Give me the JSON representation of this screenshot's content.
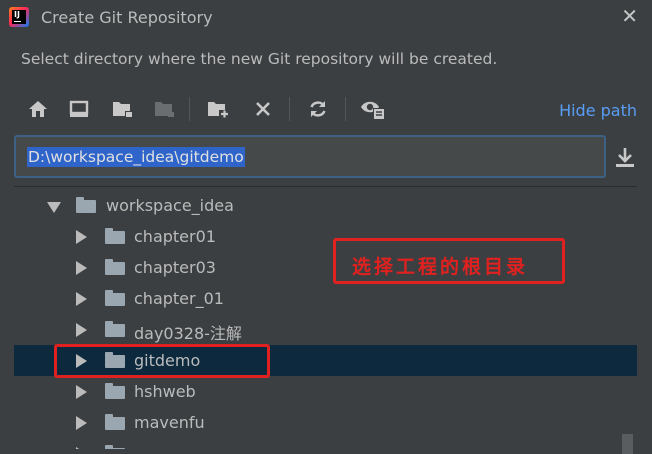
{
  "window": {
    "title": "Create Git Repository",
    "close_glyph": "✕"
  },
  "description": "Select directory where the new Git repository will be created.",
  "toolbar": {
    "buttons": [
      "home-icon",
      "desktop-icon",
      "new-folder-icon",
      "module-folder-icon",
      "new-folder-plus-icon",
      "delete-icon",
      "refresh-icon",
      "show-hidden-icon"
    ],
    "hide_path_label": "Hide path"
  },
  "path": {
    "value": "D:\\workspace_idea\\gitdemo"
  },
  "tree": {
    "items": [
      {
        "label": "workspace_idea",
        "expanded": true,
        "selected": false
      },
      {
        "label": "chapter01",
        "expanded": false,
        "selected": false
      },
      {
        "label": "chapter03",
        "expanded": false,
        "selected": false
      },
      {
        "label": "chapter_01",
        "expanded": false,
        "selected": false
      },
      {
        "label": "day0328-注解",
        "expanded": false,
        "selected": false
      },
      {
        "label": "gitdemo",
        "expanded": false,
        "selected": true
      },
      {
        "label": "hshweb",
        "expanded": false,
        "selected": false
      },
      {
        "label": "mavenfu",
        "expanded": false,
        "selected": false
      }
    ]
  },
  "annotation": {
    "text": "选择工程的根目录",
    "color": "#e0211f"
  },
  "colors": {
    "background": "#3c3f41",
    "selection": "#0d293e",
    "link": "#589df6",
    "path_highlight": "#2f65ca"
  }
}
